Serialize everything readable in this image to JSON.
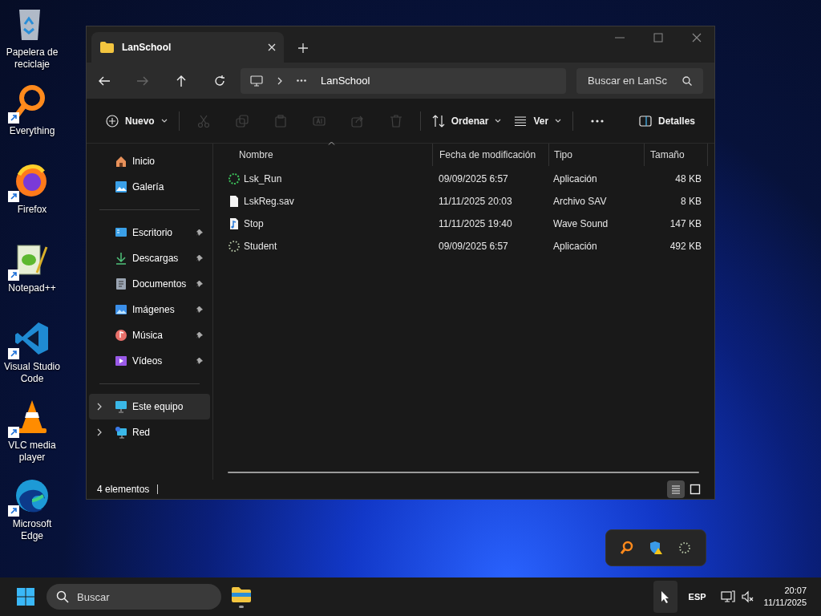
{
  "desktop_icons": [
    {
      "label": "Papelera de reciclaje",
      "kind": "recycle"
    },
    {
      "label": "Everything",
      "kind": "magnifier",
      "shortcut": true
    },
    {
      "label": "Firefox",
      "kind": "firefox",
      "shortcut": true
    },
    {
      "label": "Notepad++",
      "kind": "notepad",
      "shortcut": true
    },
    {
      "label": "Visual Studio Code",
      "kind": "vscode",
      "shortcut": true
    },
    {
      "label": "VLC media player",
      "kind": "cone",
      "shortcut": true
    },
    {
      "label": "Microsoft Edge",
      "kind": "edge",
      "shortcut": true
    }
  ],
  "window": {
    "tab": {
      "title": "LanSchool"
    },
    "address": {
      "path": "LanSchool"
    },
    "search": {
      "placeholder": "Buscar en LanSc"
    },
    "toolbar": [
      {
        "kind": "new",
        "label": "Nuevo",
        "disabled": false
      },
      {
        "kind": "cut",
        "disabled": true
      },
      {
        "kind": "copy",
        "disabled": true
      },
      {
        "kind": "paste",
        "disabled": true
      },
      {
        "kind": "rename",
        "disabled": true
      },
      {
        "kind": "share",
        "disabled": true
      },
      {
        "kind": "delete",
        "disabled": true
      },
      {
        "kind": "sort",
        "label": "Ordenar",
        "disabled": false
      },
      {
        "kind": "view",
        "label": "Ver",
        "disabled": false
      },
      {
        "kind": "more",
        "disabled": false
      },
      {
        "kind": "details",
        "label": "Detalles",
        "disabled": false
      }
    ],
    "sidebar": [
      [
        {
          "label": "Inicio",
          "kind": "home",
          "selected": false
        },
        {
          "label": "Galería",
          "kind": "gallery",
          "selected": false
        }
      ],
      [
        {
          "label": "Escritorio",
          "kind": "desktop",
          "pinned": true,
          "selected": false
        },
        {
          "label": "Descargas",
          "kind": "download",
          "pinned": true,
          "selected": false
        },
        {
          "label": "Documentos",
          "kind": "docs",
          "pinned": true,
          "selected": false
        },
        {
          "label": "Imágenes",
          "kind": "images",
          "pinned": true,
          "selected": false
        },
        {
          "label": "Música",
          "kind": "music",
          "pinned": true,
          "selected": false
        },
        {
          "label": "Vídeos",
          "kind": "videos",
          "pinned": true,
          "selected": false
        }
      ],
      [
        {
          "label": "Este equipo",
          "kind": "pc",
          "selected": true,
          "expandable": true
        },
        {
          "label": "Red",
          "kind": "network",
          "selected": false,
          "expandable": true
        }
      ]
    ],
    "columns": [
      "Nombre",
      "Fecha de modificación",
      "Tipo",
      "Tamaño"
    ],
    "rows": [
      {
        "name": "Lsk_Run",
        "kind": "ring-green",
        "date": "09/09/2025 6:57",
        "type": "Aplicación",
        "size": "48 KB"
      },
      {
        "name": "LskReg.sav",
        "kind": "file",
        "date": "11/11/2025 20:03",
        "type": "Archivo SAV",
        "size": "8 KB"
      },
      {
        "name": "Stop",
        "kind": "audio",
        "date": "11/11/2025 19:40",
        "type": "Wave Sound",
        "size": "147 KB"
      },
      {
        "name": "Student",
        "kind": "ring-grey",
        "date": "09/09/2025 6:57",
        "type": "Aplicación",
        "size": "492 KB"
      }
    ],
    "status_bar": {
      "count": "4 elementos",
      "views": [
        {
          "kind": "details",
          "selected": true
        },
        {
          "kind": "tiles",
          "selected": false
        }
      ]
    }
  },
  "tray_popup": [
    {
      "kind": "magnifier"
    },
    {
      "kind": "shield-warning"
    },
    {
      "kind": "ring-grey"
    }
  ],
  "taskbar": {
    "search": {
      "placeholder": "Buscar"
    },
    "language": "ESP",
    "time": "20:07",
    "date": "11/11/2025"
  }
}
